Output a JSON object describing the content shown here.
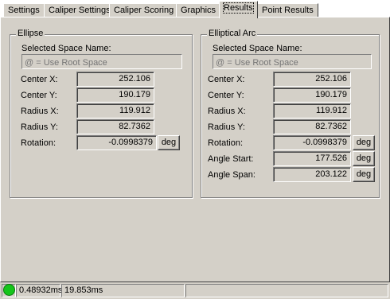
{
  "tabs": [
    {
      "label": "Settings"
    },
    {
      "label": "Caliper Settings"
    },
    {
      "label": "Caliper Scoring"
    },
    {
      "label": "Graphics"
    },
    {
      "label": "Results"
    },
    {
      "label": "Point Results"
    }
  ],
  "ellipse": {
    "title": "Ellipse",
    "space_label": "Selected Space Name:",
    "space_placeholder": "@ = Use Root Space",
    "rows": [
      {
        "label": "Center X:",
        "value": "252.106"
      },
      {
        "label": "Center Y:",
        "value": "190.179"
      },
      {
        "label": "Radius X:",
        "value": "119.912"
      },
      {
        "label": "Radius Y:",
        "value": "82.7362"
      },
      {
        "label": "Rotation:",
        "value": "-0.0998379",
        "unit": "deg"
      }
    ]
  },
  "arc": {
    "title": "Elliptical Arc",
    "space_label": "Selected Space Name:",
    "space_placeholder": "@ = Use Root Space",
    "rows": [
      {
        "label": "Center X:",
        "value": "252.106"
      },
      {
        "label": "Center Y:",
        "value": "190.179"
      },
      {
        "label": "Radius X:",
        "value": "119.912"
      },
      {
        "label": "Radius Y:",
        "value": "82.7362"
      },
      {
        "label": "Rotation:",
        "value": "-0.0998379",
        "unit": "deg"
      },
      {
        "label": "Angle Start:",
        "value": "177.526",
        "unit": "deg"
      },
      {
        "label": "Angle Span:",
        "value": "203.122",
        "unit": "deg"
      }
    ]
  },
  "status": {
    "indicator_color": "#16c51b",
    "time1": "0.48932ms",
    "time2": "19.853ms"
  }
}
